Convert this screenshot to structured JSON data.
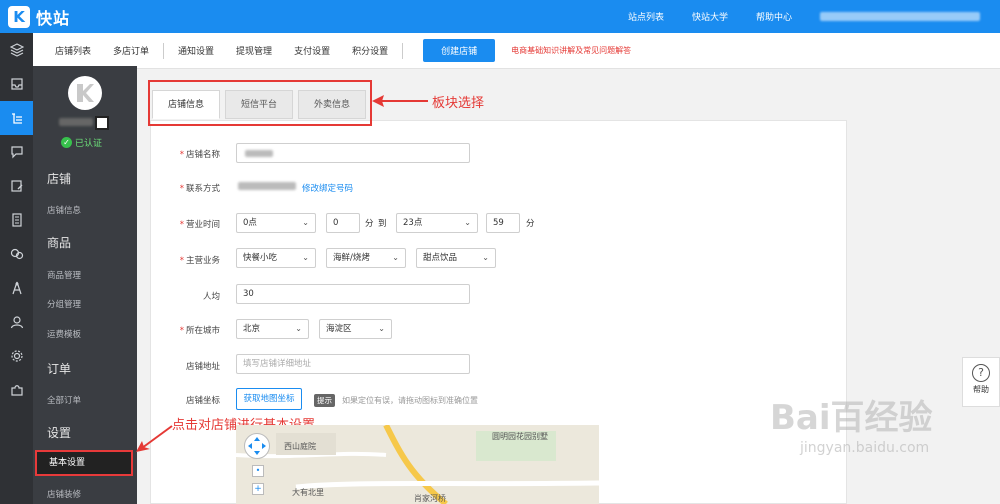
{
  "header": {
    "logo_mark": "K",
    "logo_text": "快站",
    "links": [
      "站点列表",
      "快站大学",
      "帮助中心"
    ]
  },
  "subnav": {
    "items": [
      "店铺列表",
      "多店订单",
      "通知设置",
      "提现管理",
      "支付设置",
      "积分设置"
    ],
    "create_button": "创建店铺",
    "red_link": "电商基础知识讲解及常见问题解答"
  },
  "iconbar": {
    "icons": [
      "layers-icon",
      "inbox-icon",
      "list-icon",
      "chat-icon",
      "edit-doc-icon",
      "document-icon",
      "bubbles-icon",
      "compass-icon",
      "user-icon",
      "settings-icon",
      "puzzle-icon"
    ],
    "active_index": 2
  },
  "sidebar": {
    "verified_label": "已认证",
    "sections": [
      {
        "title": "店铺",
        "items": [
          "店铺信息"
        ]
      },
      {
        "title": "商品",
        "items": [
          "商品管理",
          "分组管理",
          "运费模板"
        ]
      },
      {
        "title": "订单",
        "items": [
          "全部订单"
        ]
      },
      {
        "title": "设置",
        "items": [
          "基本设置",
          "店铺装修"
        ]
      }
    ],
    "active_item": "基本设置"
  },
  "tabs": [
    "店铺信息",
    "短信平台",
    "外卖信息"
  ],
  "active_tab": 0,
  "annotations": {
    "tabs_note": "板块选择",
    "sidebar_note": "点击对店铺进行基本设置"
  },
  "form": {
    "name_label": "店铺名称",
    "contact_label": "联系方式",
    "contact_link": "修改绑定号码",
    "hours_label": "营业时间",
    "hours": {
      "start_hour": "0点",
      "start_min": "0",
      "min_unit": "分",
      "to": "到",
      "end_hour": "23点",
      "end_min": "59",
      "end_unit": "分"
    },
    "business_label": "主营业务",
    "business": [
      "快餐小吃",
      "海鲜/烧烤",
      "甜点饮品"
    ],
    "avg_label": "人均",
    "avg_value": "30",
    "city_label": "所在城市",
    "city": "北京",
    "district": "海淀区",
    "address_label": "店铺地址",
    "address_placeholder": "填写店铺详细地址",
    "coord_label": "店铺坐标",
    "map_button": "获取地图坐标",
    "hint_badge": "提示",
    "hint_text": "如果定位有误，请拖动图标到准确位置"
  },
  "map": {
    "labels": [
      "西山庭院",
      "圆明园花园别墅",
      "大有北里",
      "肖家河桥"
    ]
  },
  "help": {
    "label": "帮助"
  },
  "watermark": {
    "main": "Bai百经验",
    "sub": "jingyan.baidu.com"
  },
  "colors": {
    "primary": "#1a8cf0",
    "accent_red": "#e53935",
    "sidebar": "#3a3d42",
    "iconbar": "#2f3135"
  }
}
